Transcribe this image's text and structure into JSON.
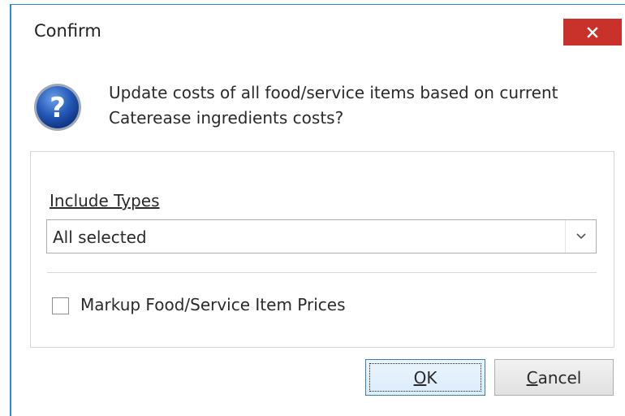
{
  "window": {
    "title": "Confirm",
    "close_icon": "close-icon"
  },
  "message": {
    "icon": "question-icon",
    "text": "Update costs of all food/service items based on current Caterease ingredients costs?"
  },
  "include_types": {
    "label": "Include Types",
    "value": "All selected"
  },
  "markup": {
    "label": "Markup Food/Service Item Prices",
    "checked": false
  },
  "buttons": {
    "ok_label": "OK",
    "cancel_label": "Cancel"
  },
  "colors": {
    "close_button": "#c8322b",
    "window_border": "#2b8ad6",
    "ok_border": "#3c7fb1"
  }
}
